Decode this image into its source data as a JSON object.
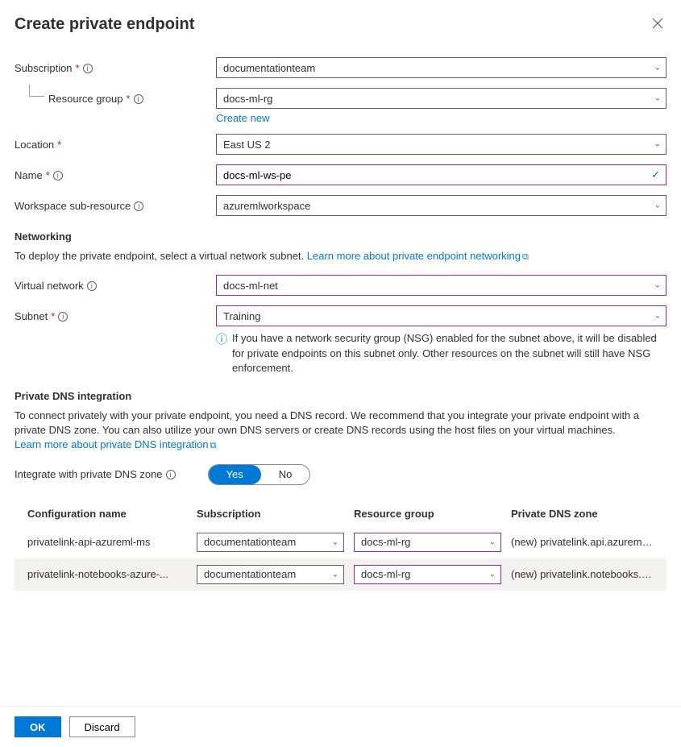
{
  "title": "Create private endpoint",
  "fields": {
    "subscription": {
      "label": "Subscription",
      "value": "documentationteam"
    },
    "resourceGroup": {
      "label": "Resource group",
      "value": "docs-ml-rg",
      "createNew": "Create new"
    },
    "location": {
      "label": "Location",
      "value": "East US 2"
    },
    "name": {
      "label": "Name",
      "value": "docs-ml-ws-pe"
    },
    "subResource": {
      "label": "Workspace sub-resource",
      "value": "azuremlworkspace"
    },
    "virtualNetwork": {
      "label": "Virtual network",
      "value": "docs-ml-net"
    },
    "subnet": {
      "label": "Subnet",
      "value": "Training"
    }
  },
  "networking": {
    "heading": "Networking",
    "desc": "To deploy the private endpoint, select a virtual network subnet. ",
    "learnMore": "Learn more about private endpoint networking",
    "nsgNote": "If you have a network security group (NSG) enabled for the subnet above, it will be disabled for private endpoints on this subnet only. Other resources on the subnet will still have NSG enforcement."
  },
  "dns": {
    "heading": "Private DNS integration",
    "desc": "To connect privately with your private endpoint, you need a DNS record. We recommend that you integrate your private endpoint with a private DNS zone. You can also utilize your own DNS servers or create DNS records using the host files on your virtual machines.",
    "learnMore": "Learn more about private DNS integration",
    "toggleLabel": "Integrate with private DNS zone",
    "yes": "Yes",
    "no": "No"
  },
  "table": {
    "headers": {
      "config": "Configuration name",
      "sub": "Subscription",
      "rg": "Resource group",
      "dns": "Private DNS zone"
    },
    "rows": [
      {
        "config": "privatelink-api-azureml-ms",
        "sub": "documentationteam",
        "rg": "docs-ml-rg",
        "dns": "(new) privatelink.api.azureml...."
      },
      {
        "config": "privatelink-notebooks-azure-...",
        "sub": "documentationteam",
        "rg": "docs-ml-rg",
        "dns": "(new) privatelink.notebooks.a..."
      }
    ]
  },
  "footer": {
    "ok": "OK",
    "discard": "Discard"
  }
}
